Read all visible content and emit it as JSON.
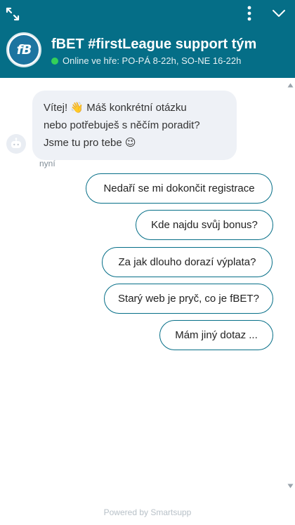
{
  "header": {
    "title": "fBET #firstLeague support tým",
    "status": "Online ve hře: PO-PÁ 8-22h, SO-NE 16-22h",
    "logo_text": "fB",
    "background_color": "#056e87",
    "status_color": "#34d058",
    "icons": {
      "expand": "expand-icon",
      "menu": "more-vertical-icon",
      "minimize": "chevron-down-icon"
    }
  },
  "conversation": {
    "bot_message": {
      "line1": "Vítej! 👋 Máš konkrétní otázku",
      "line2": "nebo potřebuješ s něčím poradit?",
      "line3": "Jsme tu pro tebe 😉",
      "time": "nyní"
    },
    "quick_replies": [
      {
        "label": "Nedaří se mi dokončit registrace"
      },
      {
        "label": "Kde najdu svůj bonus?"
      },
      {
        "label": "Za jak dlouho dorazí výplata?"
      },
      {
        "label": "Starý web je pryč, co je fBET?"
      },
      {
        "label": "Mám jiný dotaz ..."
      }
    ]
  },
  "footer": {
    "powered_by": "Powered by Smartsupp"
  }
}
